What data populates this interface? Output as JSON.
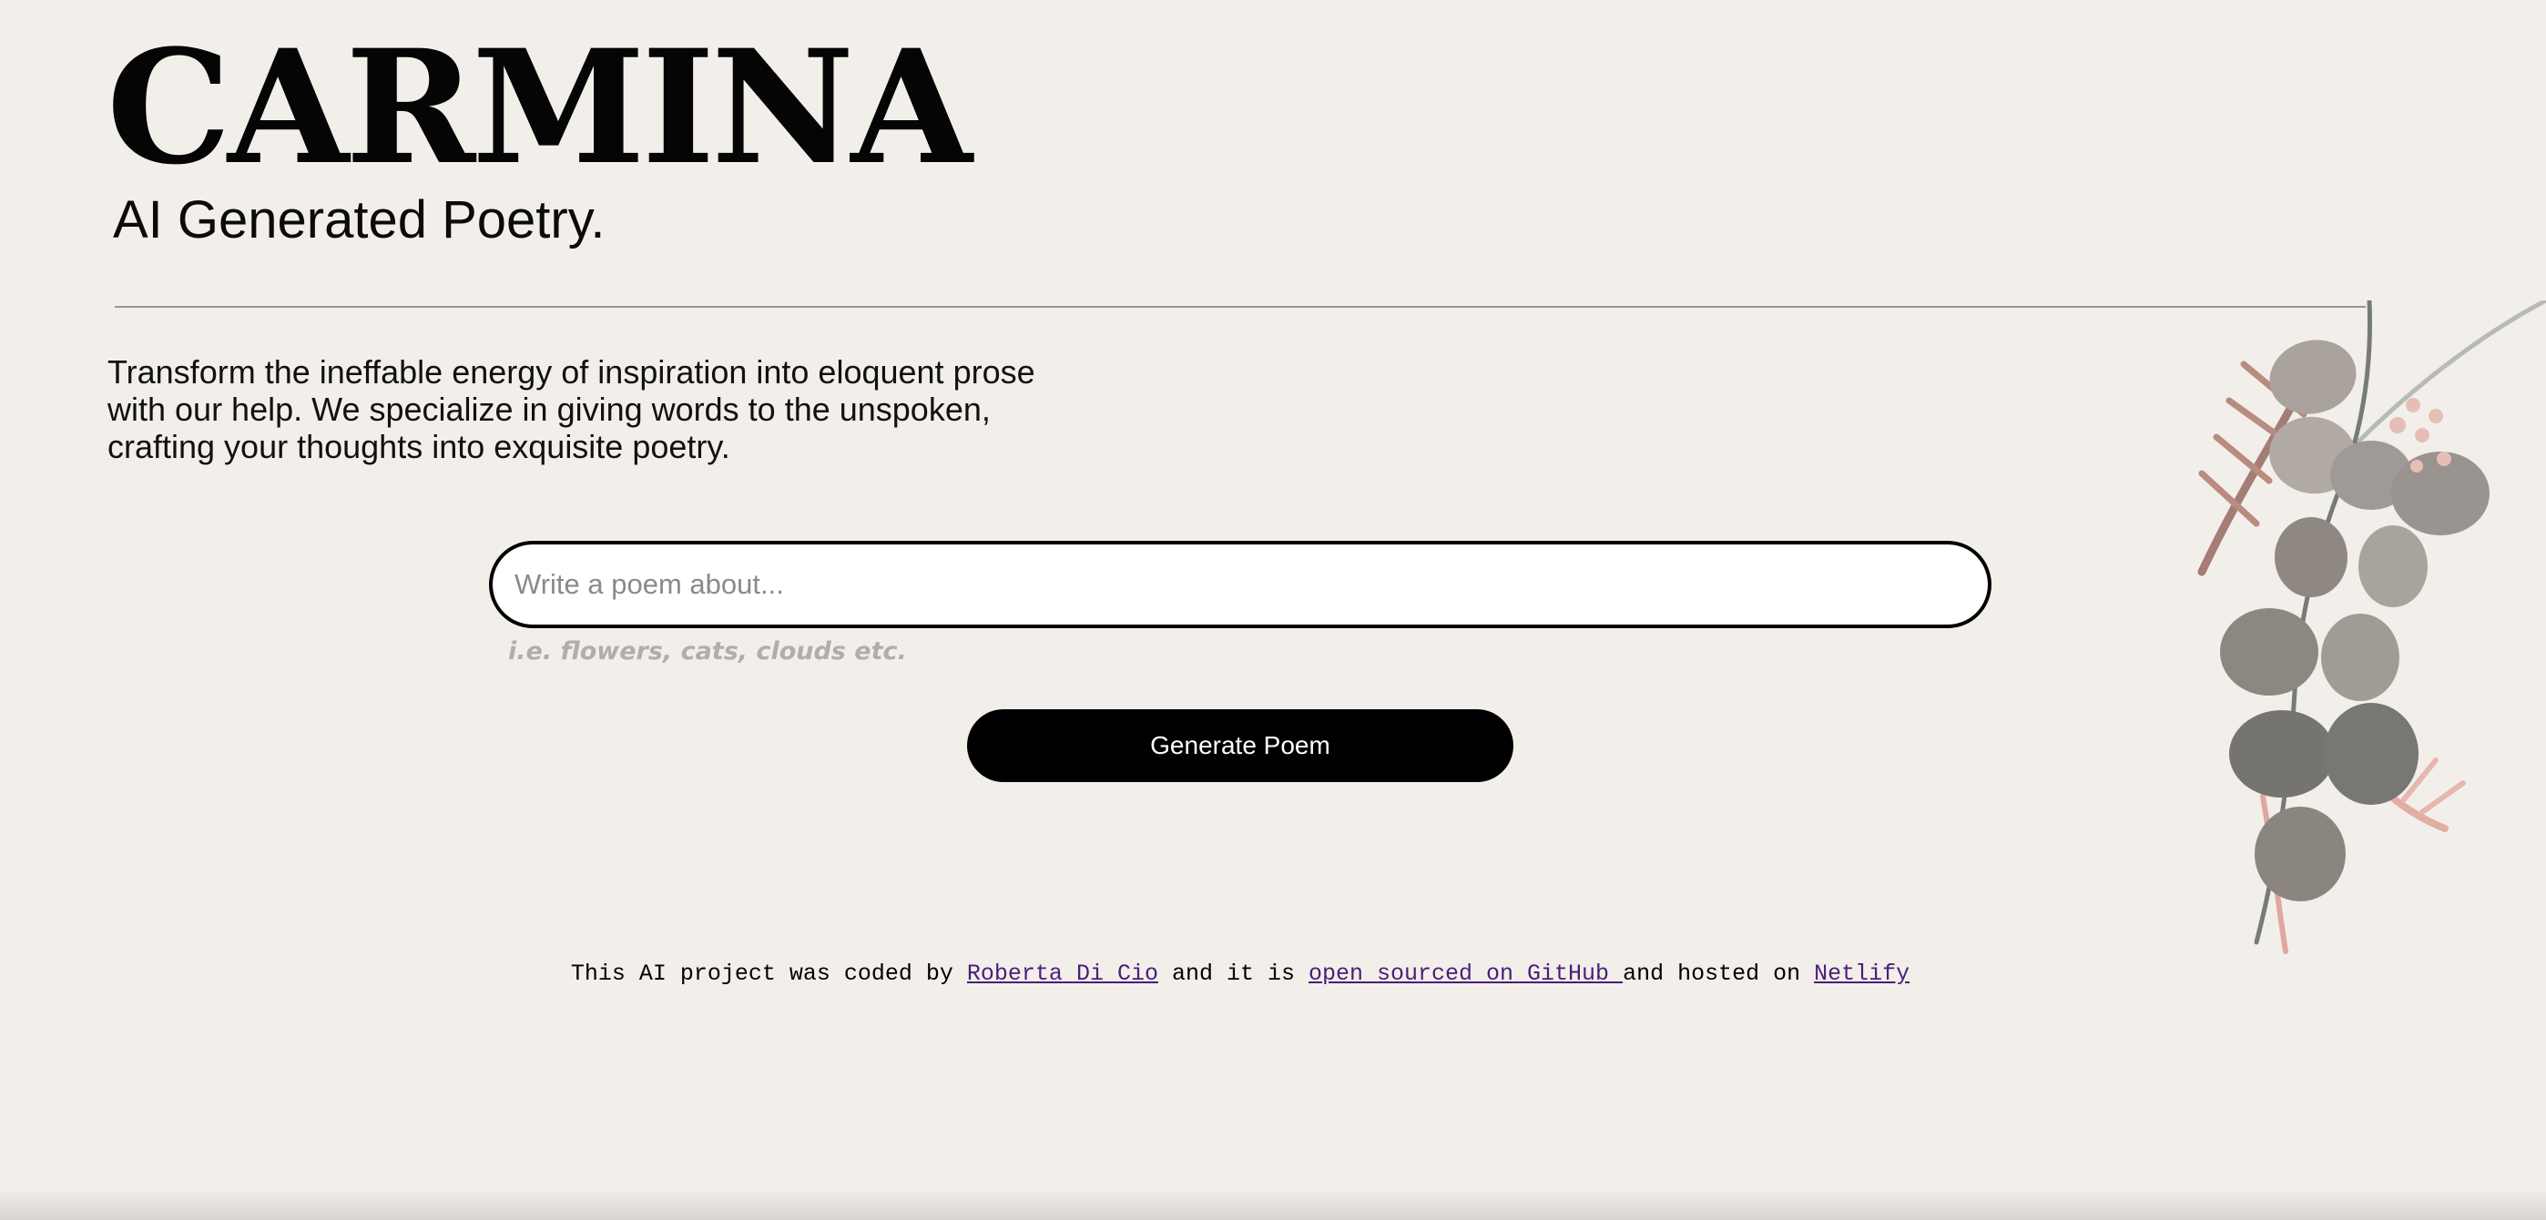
{
  "header": {
    "title": "CARMINA",
    "subtitle": "AI Generated Poetry."
  },
  "intro": {
    "text": "Transform the ineffable energy of inspiration into eloquent prose with our help. We specialize in giving words to the unspoken, crafting your thoughts into exquisite poetry."
  },
  "form": {
    "placeholder": "Write a poem about...",
    "hint": "i.e. flowers, cats, clouds etc.",
    "button_label": "Generate Poem"
  },
  "footer": {
    "prefix": "This AI project was coded by ",
    "author_link": "Roberta Di Cio",
    "middle": " and it is ",
    "github_link": "open sourced on GitHub ",
    "suffix": "and hosted on ",
    "host_link": "Netlify"
  },
  "colors": {
    "background": "#f2efea",
    "button": "#000000",
    "link": "#4b1d7a",
    "hint": "#b1aeaa"
  },
  "icons": {
    "decoration": "eucalyptus-floral-decoration"
  }
}
